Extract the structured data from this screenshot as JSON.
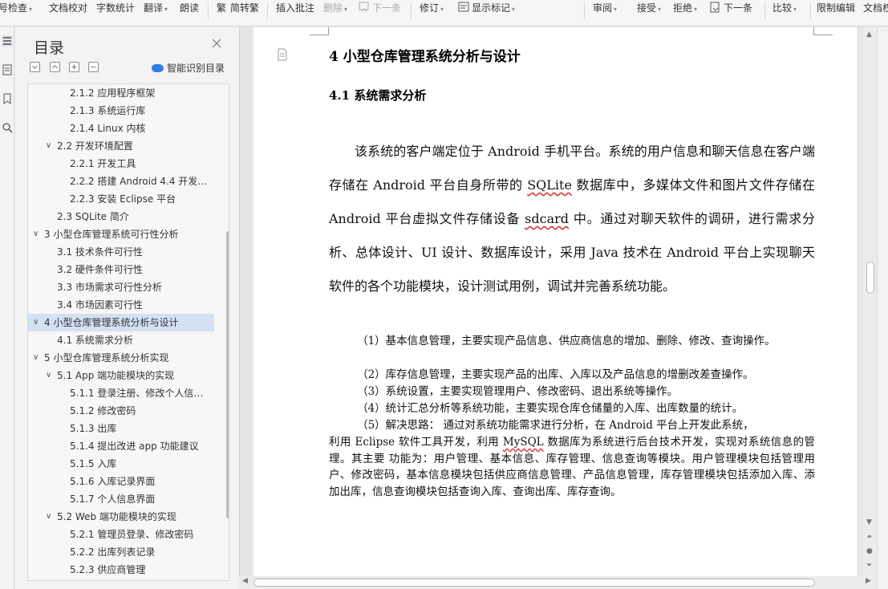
{
  "toolbar": {
    "items": [
      {
        "label": "号检查",
        "arrow": true
      },
      {
        "label": "文档校对"
      },
      {
        "label": "字数统计"
      },
      {
        "label": "翻译",
        "arrow": true
      },
      {
        "label": "朗读"
      },
      {
        "label": "简转繁"
      },
      {
        "label": "插入批注"
      },
      {
        "label": "删除",
        "arrow": true
      },
      {
        "label": "下一条"
      },
      {
        "label": "修订",
        "arrow": true
      },
      {
        "label": "显示标记",
        "arrow": true
      },
      {
        "label": "审阅",
        "arrow": true
      },
      {
        "label": "接受",
        "arrow": true
      },
      {
        "label": "拒绝",
        "arrow": true
      },
      {
        "label": "下一条"
      },
      {
        "label": "比较",
        "arrow": true
      },
      {
        "label": "限制编辑"
      },
      {
        "label": "文档权"
      }
    ]
  },
  "nav": {
    "title": "目录",
    "smart_label": "智能识别目录",
    "toc": [
      {
        "text": "2.1.2  应用程序框架",
        "level": 3
      },
      {
        "text": "2.1.3  系统运行库",
        "level": 3
      },
      {
        "text": "2.1.4 Linux 内核",
        "level": 3
      },
      {
        "text": "2.2  开发环境配置",
        "level": 2,
        "expanded": true
      },
      {
        "text": "2.2.1  开发工具",
        "level": 3
      },
      {
        "text": "2.2.2  搭建 Android 4.4 开发…",
        "level": 3
      },
      {
        "text": "2.2.3  安装 Eclipse 平台",
        "level": 3
      },
      {
        "text": "2.3 SQLite 简介",
        "level": 2
      },
      {
        "text": "3  小型仓库管理系统可行性分析",
        "level": 1,
        "expanded": true
      },
      {
        "text": "3.1  技术条件可行性",
        "level": 2
      },
      {
        "text": "3.2  硬件条件可行性",
        "level": 2
      },
      {
        "text": "3.3 市场需求可行性分析",
        "level": 2
      },
      {
        "text": "3.4  市场因素可行性",
        "level": 2
      },
      {
        "text": "4  小型仓库管理系统分析与设计",
        "level": 1,
        "expanded": true,
        "selected": true
      },
      {
        "text": "4.1  系统需求分析",
        "level": 2
      },
      {
        "text": "5  小型仓库管理系统分析实现",
        "level": 1,
        "expanded": true
      },
      {
        "text": "5.1 App 端功能模块的实现",
        "level": 2,
        "expanded": true
      },
      {
        "text": "5.1.1  登录注册、修改个人信…",
        "level": 3
      },
      {
        "text": "5.1.2 修改密码",
        "level": 3
      },
      {
        "text": "5.1.3 出库",
        "level": 3
      },
      {
        "text": "5.1.4 提出改进 app 功能建议",
        "level": 3
      },
      {
        "text": "5.1.5 入库",
        "level": 3
      },
      {
        "text": "5.1.6 入库记录界面",
        "level": 3
      },
      {
        "text": "5.1.7 个人信息界面",
        "level": 3
      },
      {
        "text": "5.2 Web 端功能模块的实现",
        "level": 2,
        "expanded": true
      },
      {
        "text": "5.2.1 管理员登录、修改密码",
        "level": 3
      },
      {
        "text": "5.2.2  出库列表记录",
        "level": 3
      },
      {
        "text": "5.2.3  供应商管理",
        "level": 3
      }
    ]
  },
  "doc": {
    "heading1": "4  小型仓库管理系统分析与设计",
    "heading2": "4.1  系统需求分析",
    "intro_parts": [
      "该系统的客户端定位于 Android 手机平台。系统的用户信息和聊天信息在客户端存储在 Android 平台自身所带的 ",
      "SQLite",
      " 数据库中，多媒体文件和图片文件存储在 Android 平台虚拟文件存储设备 ",
      "sdcard",
      " 中。通过对聊天软件的调研，进行需求分析、总体设计、UI 设计、数据库设计，采用 Java 技术在 Android 平台上实现聊天软件的各个功能模块，设计测试用例，调试并完善系统功能。"
    ],
    "items": [
      "（1）基本信息管理，主要实现产品信息、供应商信息的增加、删除、修改、查询操作。",
      "（2）库存信息管理，主要实现产品的出库、入库以及产品信息的增删改差查操作。",
      "（3）系统设置，主要实现管理用户、修改密码、退出系统等操作。",
      "（4）统计汇总分析等系统功能，主要实现仓库仓储量的入库、出库数量的统计。",
      "（5）解决思路：  通过对系统功能需求进行分析，在 Android 平台上开发此系统，"
    ],
    "continuation_parts": [
      "利用 Eclipse 软件工具开发，利用 ",
      "MySQL",
      " 数据库为系统进行后台技术开发，实现对系统信息的管理。其主要  功能为：用户管理、基本信息、库存管理、信息查询等模块。用户管理模块包括管理用户、修改密码，基本信息模块包括供应商信息管理、产品信息管理，库存管理模块包括添加入库、添加出库，信息查询模块包括查询入库、查询出库、库存查询。"
    ]
  }
}
